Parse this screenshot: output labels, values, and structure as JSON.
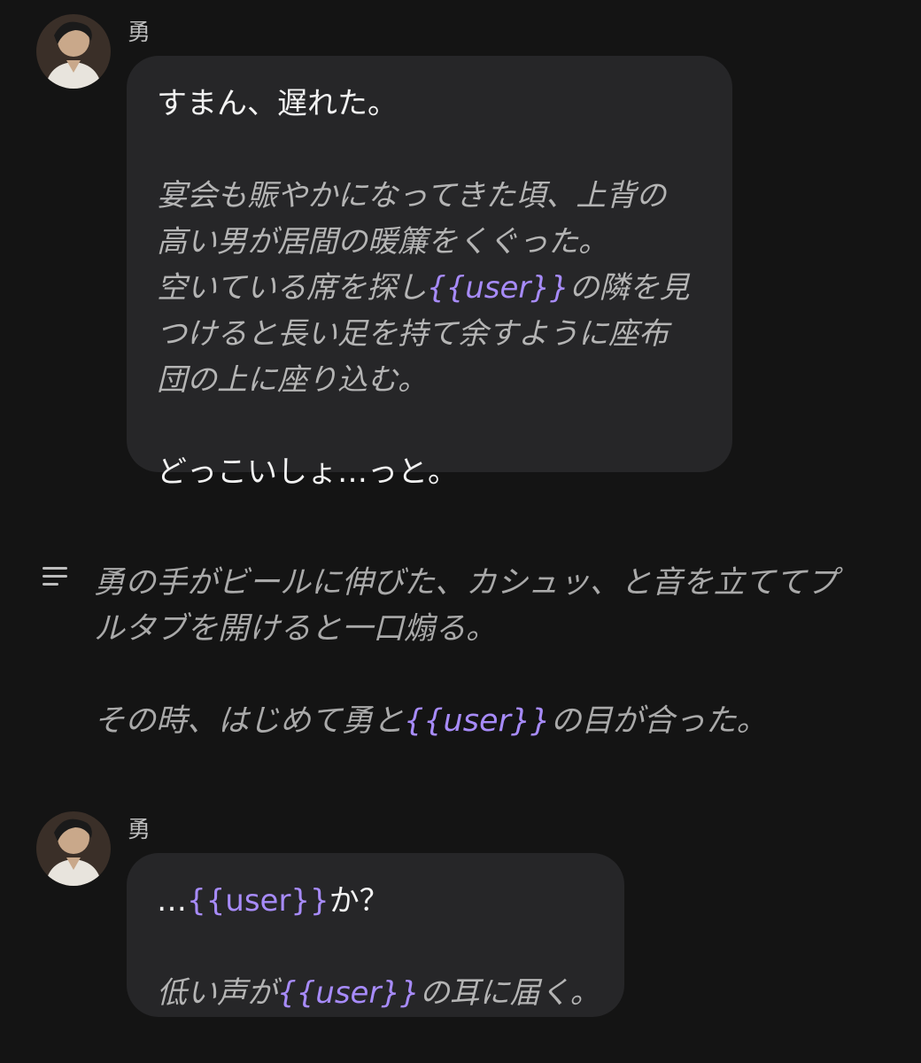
{
  "messages": [
    {
      "sender": "勇",
      "lines": [
        {
          "style": "plain",
          "segments": [
            "すまん、遅れた。"
          ]
        },
        {
          "style": "gap"
        },
        {
          "style": "italic",
          "segments": [
            "宴会も賑やかになってきた頃、上背の"
          ]
        },
        {
          "style": "italic",
          "segments": [
            "高い男が居間の暖簾をくぐった。"
          ]
        },
        {
          "style": "italic",
          "segments": [
            "空いている席を探し",
            "{{user}}",
            "の隣を見"
          ]
        },
        {
          "style": "italic",
          "segments": [
            "つけると長い足を持て余すように座布"
          ]
        },
        {
          "style": "italic",
          "segments": [
            "団の上に座り込む。"
          ]
        },
        {
          "style": "gap"
        },
        {
          "style": "plain",
          "segments": [
            "どっこいしょ…っと。"
          ]
        }
      ]
    },
    {
      "sender": "勇",
      "lines": [
        {
          "style": "plain",
          "segments": [
            "…",
            "{{user}}",
            "か？"
          ]
        },
        {
          "style": "gap"
        },
        {
          "style": "italic",
          "segments": [
            "低い声が",
            "{{user}}",
            "の耳に届く。"
          ]
        }
      ]
    }
  ],
  "narration": {
    "icon": "text-lines-icon",
    "lines": [
      {
        "style": "italic",
        "segments": [
          "勇の手がビールに伸びた、カシュッ、と音を立ててプ"
        ]
      },
      {
        "style": "italic",
        "segments": [
          "ルタブを開けると一口煽る。"
        ]
      },
      {
        "style": "gap"
      },
      {
        "style": "italic",
        "segments": [
          "その時、はじめて勇と",
          "{{user}}",
          "の目が合った。"
        ]
      }
    ]
  },
  "colors": {
    "background": "#141414",
    "bubble": "#262628",
    "user_tag": "#a78bfa"
  }
}
